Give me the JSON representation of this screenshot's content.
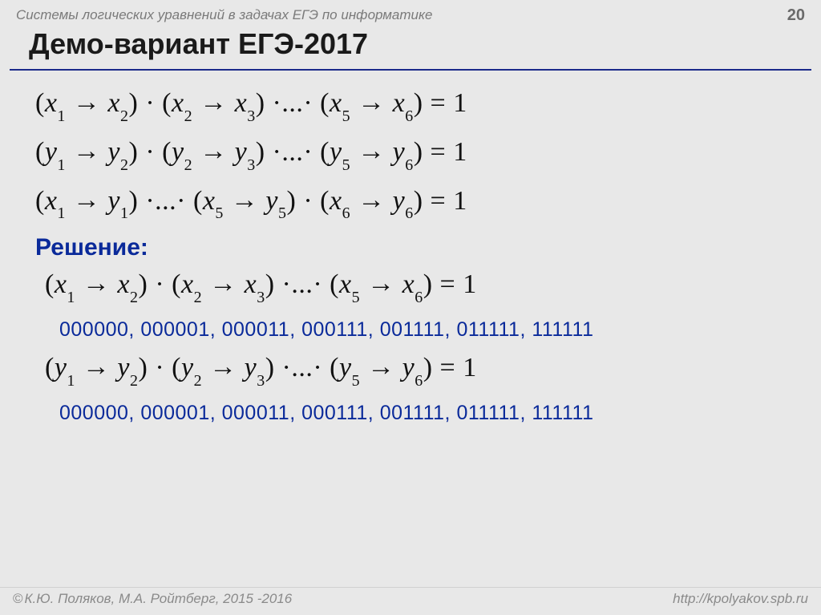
{
  "header": {
    "subject": "Системы логических уравнений в задачах ЕГЭ по информатике",
    "page_number": "20"
  },
  "title": "Демо-вариант ЕГЭ-2017",
  "equations": {
    "eq1": {
      "v": "x",
      "pairs": [
        [
          "1",
          "2"
        ],
        [
          "2",
          "3"
        ]
      ],
      "mid_ellipsis": "...",
      "last": [
        "5",
        "6"
      ],
      "rhs": "1"
    },
    "eq2": {
      "v": "y",
      "pairs": [
        [
          "1",
          "2"
        ],
        [
          "2",
          "3"
        ]
      ],
      "mid_ellipsis": "...",
      "last": [
        "5",
        "6"
      ],
      "rhs": "1"
    },
    "eq3": {
      "first": {
        "xv": "x",
        "xi": "1",
        "yv": "y",
        "yi": "1"
      },
      "mid_ellipsis": "...",
      "tail": [
        {
          "xv": "x",
          "xi": "5",
          "yv": "y",
          "yi": "5"
        },
        {
          "xv": "x",
          "xi": "6",
          "yv": "y",
          "yi": "6"
        }
      ],
      "rhs": "1"
    }
  },
  "solution": {
    "label": "Решение:",
    "eq_x": {
      "v": "x",
      "pairs": [
        [
          "1",
          "2"
        ],
        [
          "2",
          "3"
        ]
      ],
      "mid_ellipsis": "...",
      "last": [
        "5",
        "6"
      ],
      "rhs": "1"
    },
    "bits_x": "000000, 000001, 000011, 000111, 001111, 011111, 111111",
    "eq_y": {
      "v": "y",
      "pairs": [
        [
          "1",
          "2"
        ],
        [
          "2",
          "3"
        ]
      ],
      "mid_ellipsis": "...",
      "last": [
        "5",
        "6"
      ],
      "rhs": "1"
    },
    "bits_y": "000000, 000001, 000011, 000111, 001111, 011111, 111111"
  },
  "footer": {
    "authors": "К.Ю. Поляков, М.А. Ройтберг, 2015 -2016",
    "url": "http://kpolyakov.spb.ru"
  },
  "glyphs": {
    "arrow": "→",
    "dot": "·",
    "copyright": "©"
  }
}
